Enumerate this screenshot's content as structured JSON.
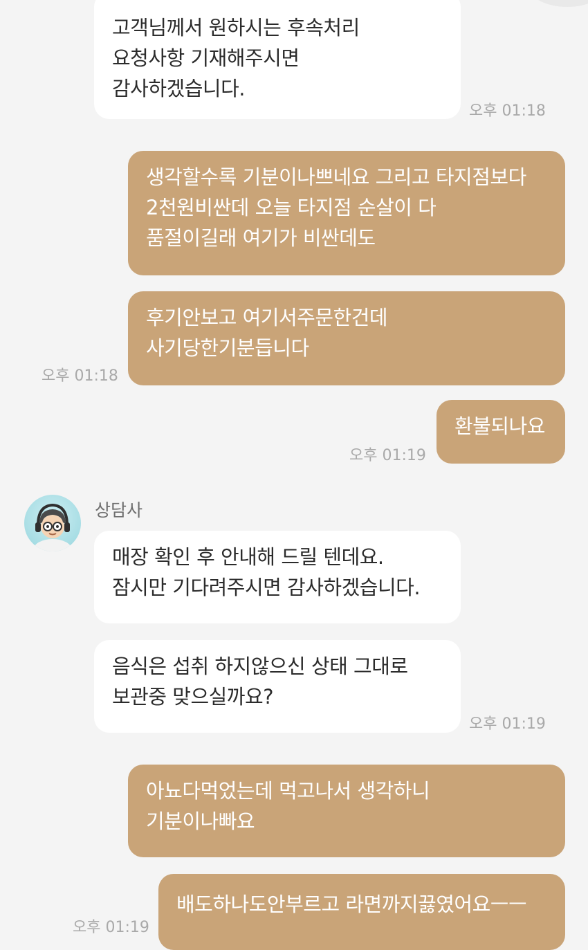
{
  "agent": {
    "name": "상담사"
  },
  "messages": [
    {
      "lines": [
        "고객님께서 원하시는 후속처리",
        "요청사항 기재해주시면",
        "감사하겠습니다."
      ],
      "time": "오후 01:18"
    },
    {
      "lines": [
        "생각할수록 기분이나쁘네요 그리고 타지점보다",
        "2천원비싼데 오늘 타지점 순살이 다",
        "품절이길래 여기가 비싼데도"
      ]
    },
    {
      "lines": [
        "후기안보고 여기서주문한건데",
        "사기당한기분듭니다"
      ],
      "time": "오후 01:18"
    },
    {
      "lines": [
        "환불되나요"
      ],
      "time": "오후 01:19"
    },
    {
      "lines": [
        "매장 확인 후 안내해 드릴 텐데요.",
        "잠시만 기다려주시면 감사하겠습니다."
      ]
    },
    {
      "lines": [
        "음식은 섭취 하지않으신 상태 그대로",
        "보관중 맞으실까요?"
      ],
      "time": "오후 01:19"
    },
    {
      "lines": [
        "아뇨다먹었는데 먹고나서 생각하니",
        "기분이나빠요"
      ]
    },
    {
      "lines": [
        "배도하나도안부르고 라면까지끓였어요ㅡㅡ"
      ],
      "time": "오후 01:19"
    }
  ]
}
